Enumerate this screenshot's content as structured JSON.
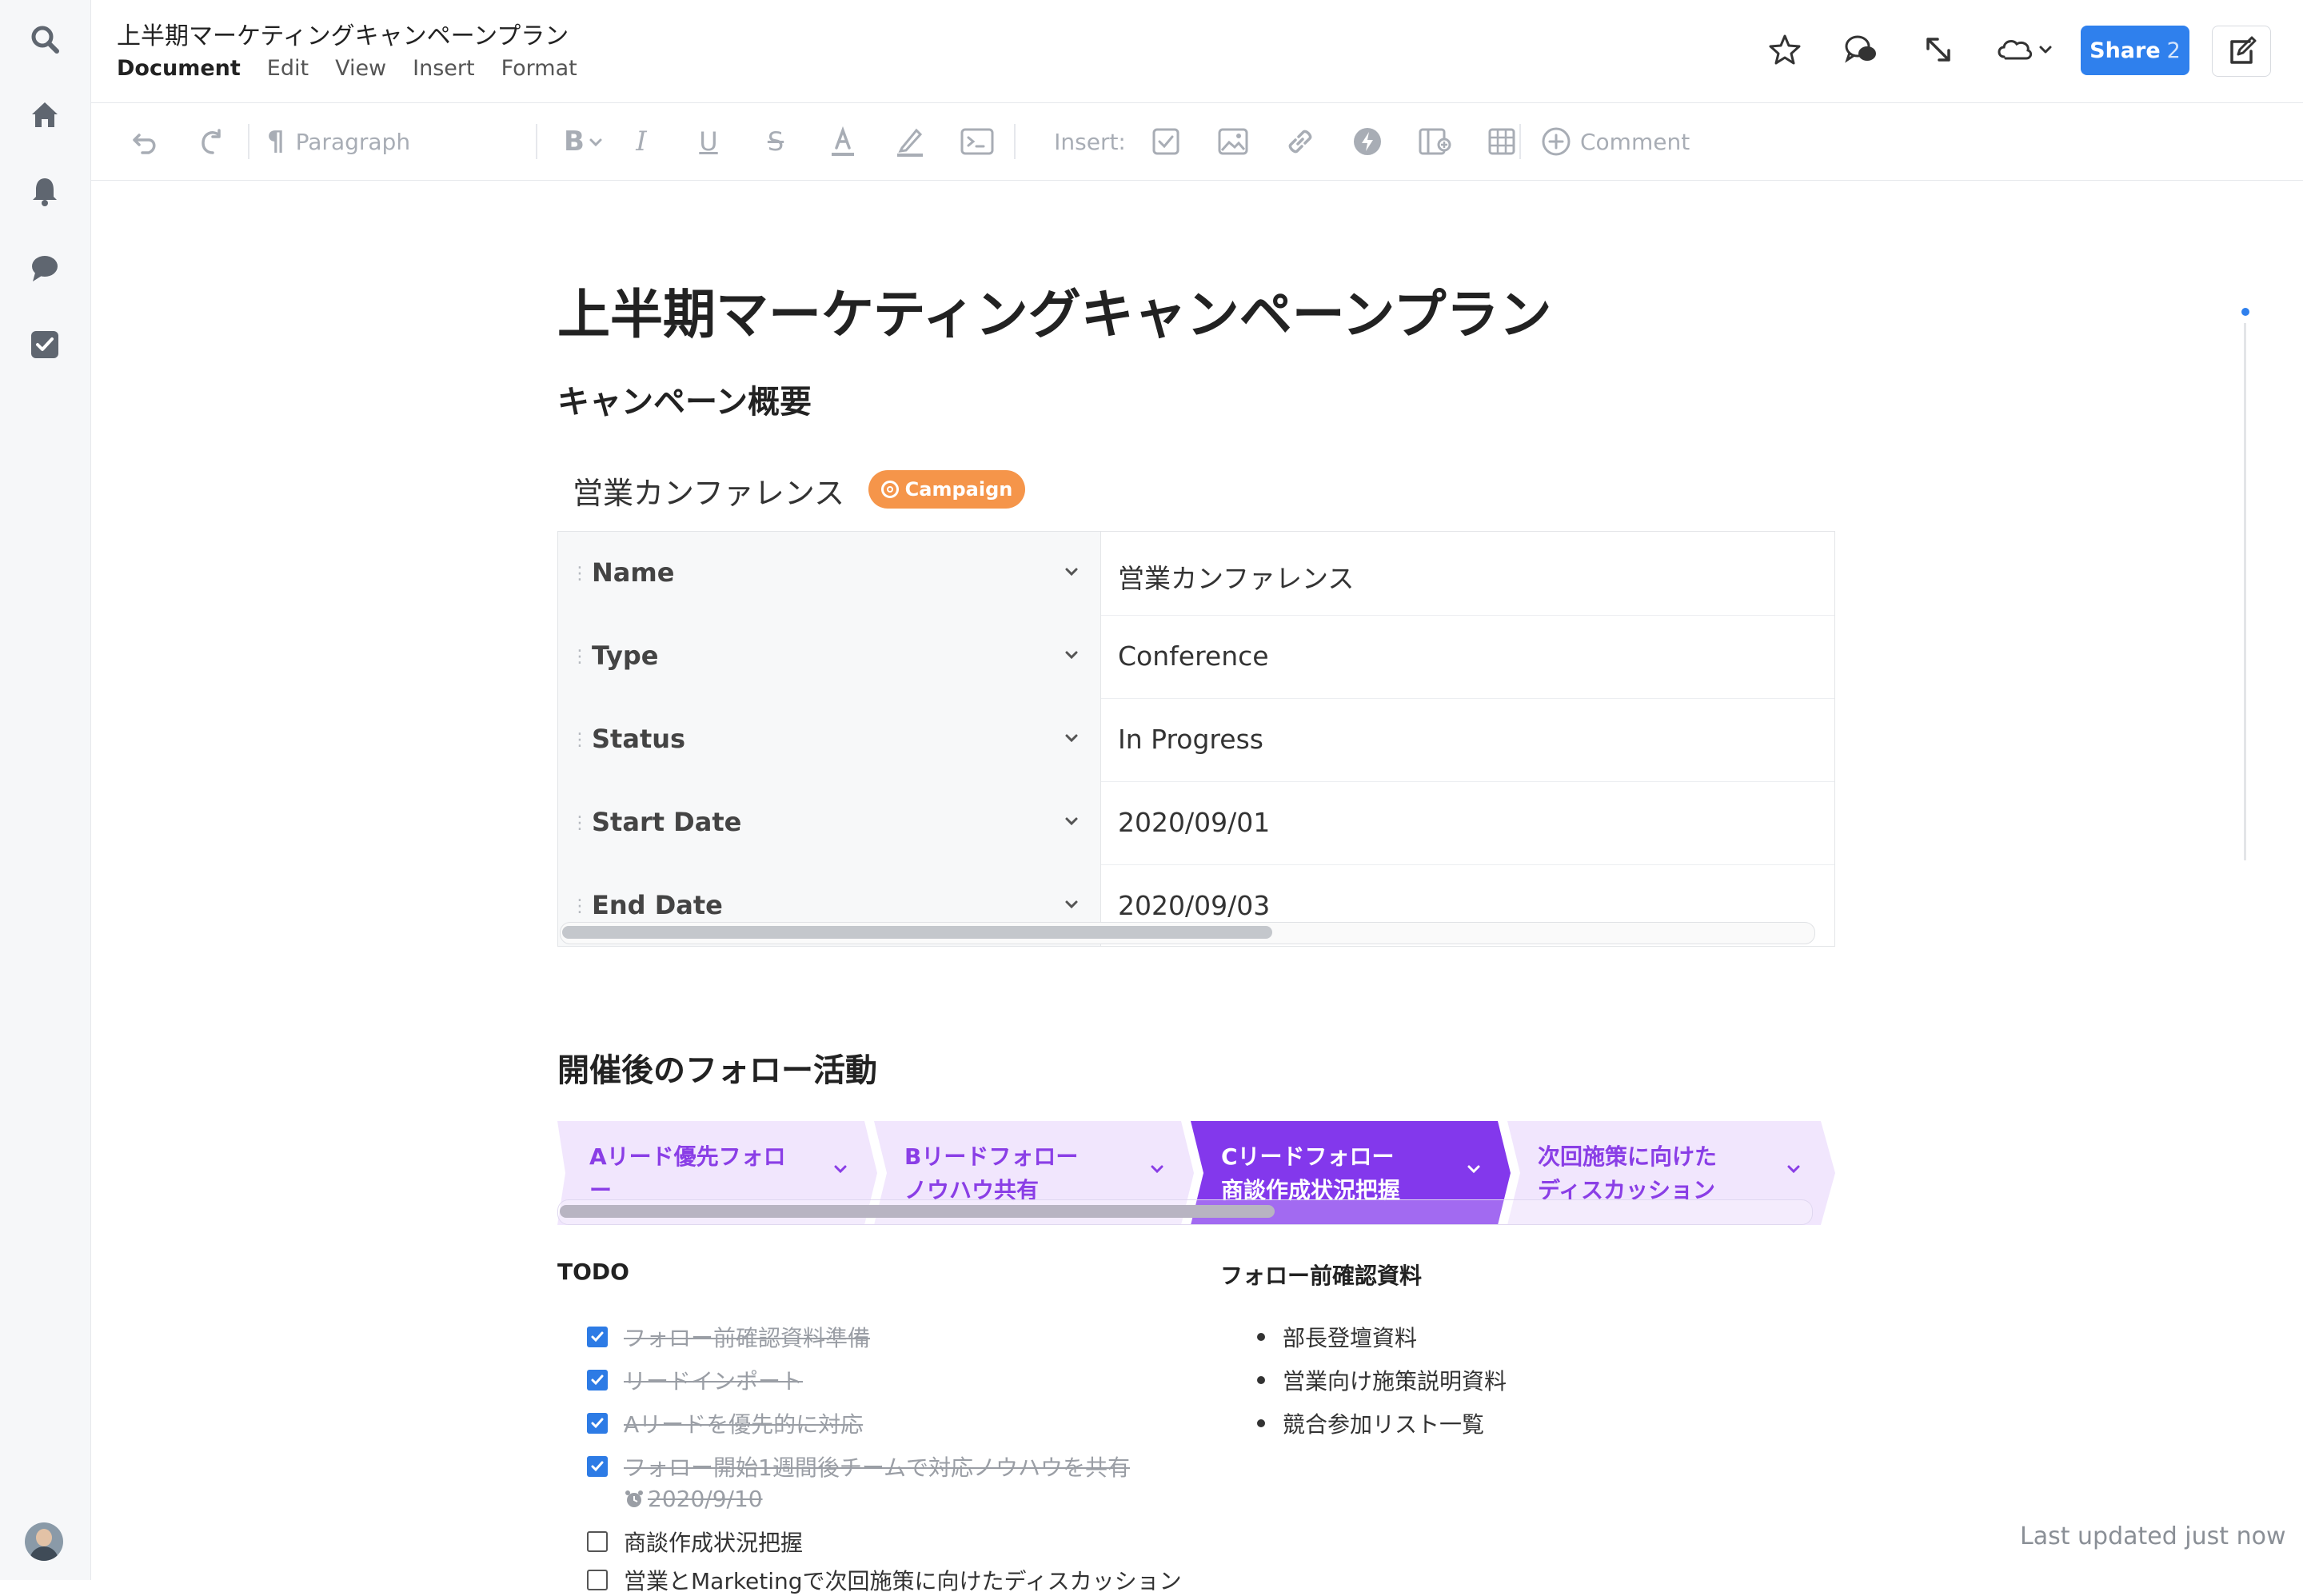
{
  "document": {
    "title": "上半期マーケティングキャンペーンプラン",
    "menu": [
      "Document",
      "Edit",
      "View",
      "Insert",
      "Format"
    ]
  },
  "header": {
    "share_label": "Share",
    "share_count": "2"
  },
  "toolbar": {
    "paragraph_label": "Paragraph",
    "insert_label": "Insert:",
    "comment_label": "Comment"
  },
  "content": {
    "heading": "上半期マーケティングキャンペーンプラン",
    "section1": "キャンペーン概要",
    "card_title": "営業カンファレンス",
    "badge": "Campaign",
    "properties": [
      {
        "key": "Name",
        "value": "営業カンファレンス"
      },
      {
        "key": "Type",
        "value": "Conference"
      },
      {
        "key": "Status",
        "value": "In Progress"
      },
      {
        "key": "Start Date",
        "value": "2020/09/01"
      },
      {
        "key": "End Date",
        "value": "2020/09/03"
      }
    ],
    "section2": "開催後のフォロー活動",
    "steps": [
      {
        "line1": "Aリード優先フォロ",
        "line2": "ー",
        "active": false
      },
      {
        "line1": "Bリードフォロー",
        "line2": "ノウハウ共有",
        "active": false
      },
      {
        "line1": "Cリードフォロー",
        "line2": "商談作成状況把握",
        "active": true
      },
      {
        "line1": "次回施策に向けた",
        "line2": "ディスカッション",
        "active": false
      }
    ],
    "todo_title": "TODO",
    "todos": [
      {
        "text": "フォロー前確認資料準備",
        "done": true
      },
      {
        "text": "リードインポート",
        "done": true
      },
      {
        "text": "Aリードを優先的に対応",
        "done": true
      },
      {
        "text": "フォロー開始1週間後チームで対応ノウハウを共有",
        "done": true
      },
      {
        "text": "商談作成状況把握",
        "done": false
      },
      {
        "text": "営業とMarketingで次回施策に向けたディスカッション",
        "done": false
      }
    ],
    "todo_due": "2020/9/10",
    "docs_title": "フォロー前確認資料",
    "docs": [
      "部長登壇資料",
      "営業向け施策説明資料",
      "競合参加リスト一覧"
    ]
  },
  "status": {
    "last_updated": "Last updated just now"
  },
  "colors": {
    "accent": "#2f80ed",
    "badge": "#f5954a",
    "step_active": "#8338ec",
    "step_inactive": "#f1e6fd",
    "step_text": "#8a3ee6"
  }
}
